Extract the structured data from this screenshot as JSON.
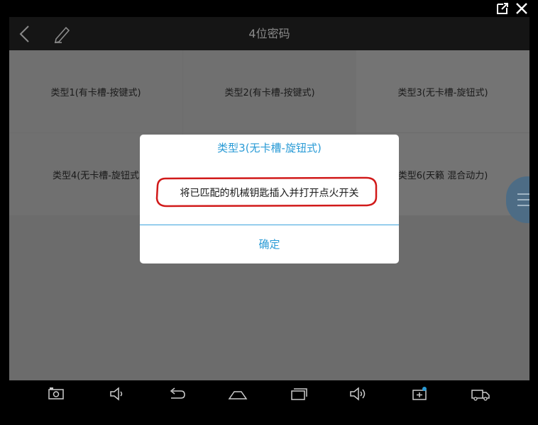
{
  "header": {
    "title": "4位密码",
    "back_icon": "chevron-left-icon",
    "edit_icon": "pencil-icon"
  },
  "grid": {
    "items": [
      {
        "label": "类型1(有卡槽-按键式)"
      },
      {
        "label": "类型2(有卡槽-按键式)"
      },
      {
        "label": "类型3(无卡槽-旋钮式)"
      },
      {
        "label": "类型4(无卡槽-旋钮式"
      },
      {
        "label": ""
      },
      {
        "label": "类型6(天籁 混合动力)"
      }
    ]
  },
  "dialog": {
    "title": "类型3(无卡槽-旋钮式)",
    "message": "将已匹配的机械钥匙插入并打开点火开关",
    "confirm_label": "确定",
    "accent_color": "#2a9bd6",
    "highlight_color": "#d11a1a"
  },
  "navbar": {
    "icons": [
      "screenshot-icon",
      "volume-down-icon",
      "back-icon",
      "home-icon",
      "recent-apps-icon",
      "volume-up-icon",
      "battery-icon",
      "truck-icon"
    ]
  },
  "window": {
    "icons": [
      "popout-icon",
      "close-icon"
    ]
  }
}
